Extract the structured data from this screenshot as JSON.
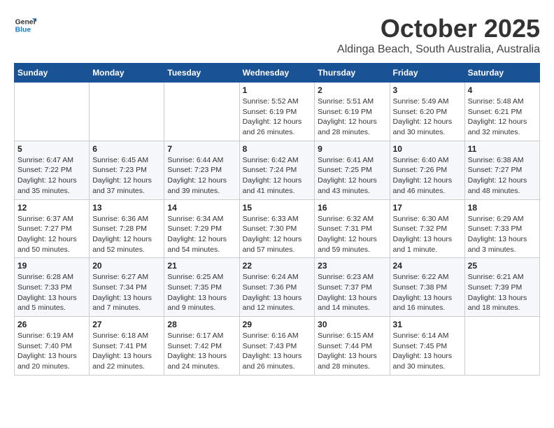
{
  "logo": {
    "line1": "General",
    "line2": "Blue"
  },
  "title": "October 2025",
  "subtitle": "Aldinga Beach, South Australia, Australia",
  "weekdays": [
    "Sunday",
    "Monday",
    "Tuesday",
    "Wednesday",
    "Thursday",
    "Friday",
    "Saturday"
  ],
  "weeks": [
    [
      {
        "day": "",
        "info": ""
      },
      {
        "day": "",
        "info": ""
      },
      {
        "day": "",
        "info": ""
      },
      {
        "day": "1",
        "info": "Sunrise: 5:52 AM\nSunset: 6:19 PM\nDaylight: 12 hours\nand 26 minutes."
      },
      {
        "day": "2",
        "info": "Sunrise: 5:51 AM\nSunset: 6:19 PM\nDaylight: 12 hours\nand 28 minutes."
      },
      {
        "day": "3",
        "info": "Sunrise: 5:49 AM\nSunset: 6:20 PM\nDaylight: 12 hours\nand 30 minutes."
      },
      {
        "day": "4",
        "info": "Sunrise: 5:48 AM\nSunset: 6:21 PM\nDaylight: 12 hours\nand 32 minutes."
      }
    ],
    [
      {
        "day": "5",
        "info": "Sunrise: 6:47 AM\nSunset: 7:22 PM\nDaylight: 12 hours\nand 35 minutes."
      },
      {
        "day": "6",
        "info": "Sunrise: 6:45 AM\nSunset: 7:23 PM\nDaylight: 12 hours\nand 37 minutes."
      },
      {
        "day": "7",
        "info": "Sunrise: 6:44 AM\nSunset: 7:23 PM\nDaylight: 12 hours\nand 39 minutes."
      },
      {
        "day": "8",
        "info": "Sunrise: 6:42 AM\nSunset: 7:24 PM\nDaylight: 12 hours\nand 41 minutes."
      },
      {
        "day": "9",
        "info": "Sunrise: 6:41 AM\nSunset: 7:25 PM\nDaylight: 12 hours\nand 43 minutes."
      },
      {
        "day": "10",
        "info": "Sunrise: 6:40 AM\nSunset: 7:26 PM\nDaylight: 12 hours\nand 46 minutes."
      },
      {
        "day": "11",
        "info": "Sunrise: 6:38 AM\nSunset: 7:27 PM\nDaylight: 12 hours\nand 48 minutes."
      }
    ],
    [
      {
        "day": "12",
        "info": "Sunrise: 6:37 AM\nSunset: 7:27 PM\nDaylight: 12 hours\nand 50 minutes."
      },
      {
        "day": "13",
        "info": "Sunrise: 6:36 AM\nSunset: 7:28 PM\nDaylight: 12 hours\nand 52 minutes."
      },
      {
        "day": "14",
        "info": "Sunrise: 6:34 AM\nSunset: 7:29 PM\nDaylight: 12 hours\nand 54 minutes."
      },
      {
        "day": "15",
        "info": "Sunrise: 6:33 AM\nSunset: 7:30 PM\nDaylight: 12 hours\nand 57 minutes."
      },
      {
        "day": "16",
        "info": "Sunrise: 6:32 AM\nSunset: 7:31 PM\nDaylight: 12 hours\nand 59 minutes."
      },
      {
        "day": "17",
        "info": "Sunrise: 6:30 AM\nSunset: 7:32 PM\nDaylight: 13 hours\nand 1 minute."
      },
      {
        "day": "18",
        "info": "Sunrise: 6:29 AM\nSunset: 7:33 PM\nDaylight: 13 hours\nand 3 minutes."
      }
    ],
    [
      {
        "day": "19",
        "info": "Sunrise: 6:28 AM\nSunset: 7:33 PM\nDaylight: 13 hours\nand 5 minutes."
      },
      {
        "day": "20",
        "info": "Sunrise: 6:27 AM\nSunset: 7:34 PM\nDaylight: 13 hours\nand 7 minutes."
      },
      {
        "day": "21",
        "info": "Sunrise: 6:25 AM\nSunset: 7:35 PM\nDaylight: 13 hours\nand 9 minutes."
      },
      {
        "day": "22",
        "info": "Sunrise: 6:24 AM\nSunset: 7:36 PM\nDaylight: 13 hours\nand 12 minutes."
      },
      {
        "day": "23",
        "info": "Sunrise: 6:23 AM\nSunset: 7:37 PM\nDaylight: 13 hours\nand 14 minutes."
      },
      {
        "day": "24",
        "info": "Sunrise: 6:22 AM\nSunset: 7:38 PM\nDaylight: 13 hours\nand 16 minutes."
      },
      {
        "day": "25",
        "info": "Sunrise: 6:21 AM\nSunset: 7:39 PM\nDaylight: 13 hours\nand 18 minutes."
      }
    ],
    [
      {
        "day": "26",
        "info": "Sunrise: 6:19 AM\nSunset: 7:40 PM\nDaylight: 13 hours\nand 20 minutes."
      },
      {
        "day": "27",
        "info": "Sunrise: 6:18 AM\nSunset: 7:41 PM\nDaylight: 13 hours\nand 22 minutes."
      },
      {
        "day": "28",
        "info": "Sunrise: 6:17 AM\nSunset: 7:42 PM\nDaylight: 13 hours\nand 24 minutes."
      },
      {
        "day": "29",
        "info": "Sunrise: 6:16 AM\nSunset: 7:43 PM\nDaylight: 13 hours\nand 26 minutes."
      },
      {
        "day": "30",
        "info": "Sunrise: 6:15 AM\nSunset: 7:44 PM\nDaylight: 13 hours\nand 28 minutes."
      },
      {
        "day": "31",
        "info": "Sunrise: 6:14 AM\nSunset: 7:45 PM\nDaylight: 13 hours\nand 30 minutes."
      },
      {
        "day": "",
        "info": ""
      }
    ]
  ]
}
